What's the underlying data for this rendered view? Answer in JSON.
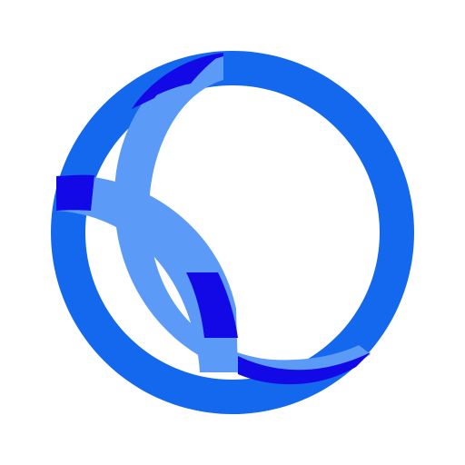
{
  "logo": {
    "icon": "interlocking-rings-logo-icon",
    "colors": {
      "ring_primary": "#1468EE",
      "ring_light": "#5B9BF7",
      "overlap_dark": "#1308E6",
      "background": "#FFFFFF"
    }
  }
}
